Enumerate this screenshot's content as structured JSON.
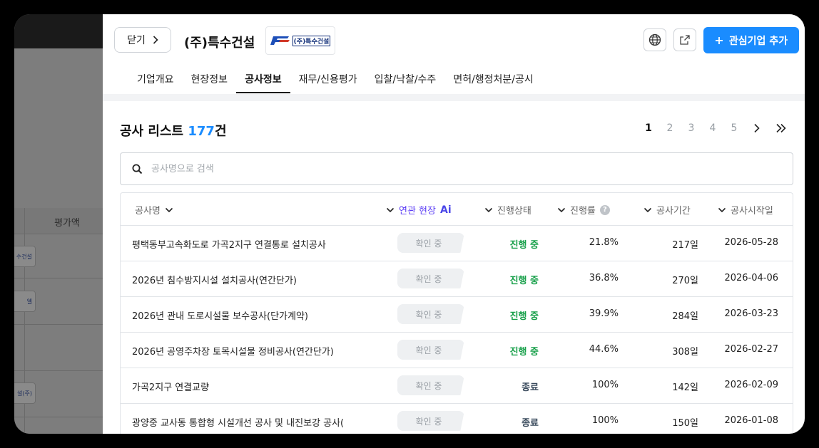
{
  "background": {
    "column_header": "평가액",
    "logo_snippets": [
      "수건설",
      "엘",
      "설(주)"
    ]
  },
  "header": {
    "close_label": "닫기",
    "company_name": "(주)특수건설",
    "company_logo_text": "(주)특수건설",
    "add_button_label": "관심기업 추가",
    "icons": [
      "globe-icon",
      "external-link-icon"
    ]
  },
  "tabs": [
    {
      "label": "기업개요"
    },
    {
      "label": "현장정보"
    },
    {
      "label": "공사정보"
    },
    {
      "label": "재무/신용평가"
    },
    {
      "label": "입찰/낙찰/수주"
    },
    {
      "label": "면허/행정처분/공시"
    }
  ],
  "active_tab": "공사정보",
  "list": {
    "title": "공사 리스트",
    "count": "177",
    "count_suffix": "건"
  },
  "pagination": {
    "pages": [
      "1",
      "2",
      "3",
      "4",
      "5"
    ],
    "current": "1"
  },
  "search": {
    "placeholder": "공사명으로 검색",
    "value": ""
  },
  "table": {
    "columns": {
      "name": "공사명",
      "related": "연관 현장",
      "related_ai": "Ai",
      "status": "진행상태",
      "rate": "진행률",
      "period": "공사기간",
      "start": "공사시작일"
    },
    "rows": [
      {
        "name": "평택동부고속화도로 가곡2지구 연결통로 설치공사",
        "related": "확인 중",
        "status": "진행 중",
        "rate": "21.8%",
        "period": "217일",
        "start": "2026-05-28"
      },
      {
        "name": "2026년 침수방지시설 설치공사(연간단가)",
        "related": "확인 중",
        "status": "진행 중",
        "rate": "36.8%",
        "period": "270일",
        "start": "2026-04-06"
      },
      {
        "name": "2026년 관내 도로시설물 보수공사(단가계약)",
        "related": "확인 중",
        "status": "진행 중",
        "rate": "39.9%",
        "period": "284일",
        "start": "2026-03-23"
      },
      {
        "name": "2026년 공영주차장 토목시설물 정비공사(연간단가)",
        "related": "확인 중",
        "status": "진행 중",
        "rate": "44.6%",
        "period": "308일",
        "start": "2026-02-27"
      },
      {
        "name": "가곡2지구 연결교량",
        "related": "확인 중",
        "status": "종료",
        "rate": "100%",
        "period": "142일",
        "start": "2026-02-09"
      },
      {
        "name": "광양중 교사동 통합형 시설개선 공사 및 내진보강 공사(",
        "related": "확인 중",
        "status": "종료",
        "rate": "100%",
        "period": "150일",
        "start": "2026-01-08"
      }
    ]
  },
  "colors": {
    "accent": "#1a8cff",
    "status_active": "#18a04a",
    "status_done": "#394a5c",
    "ai": "#5b3df5"
  }
}
